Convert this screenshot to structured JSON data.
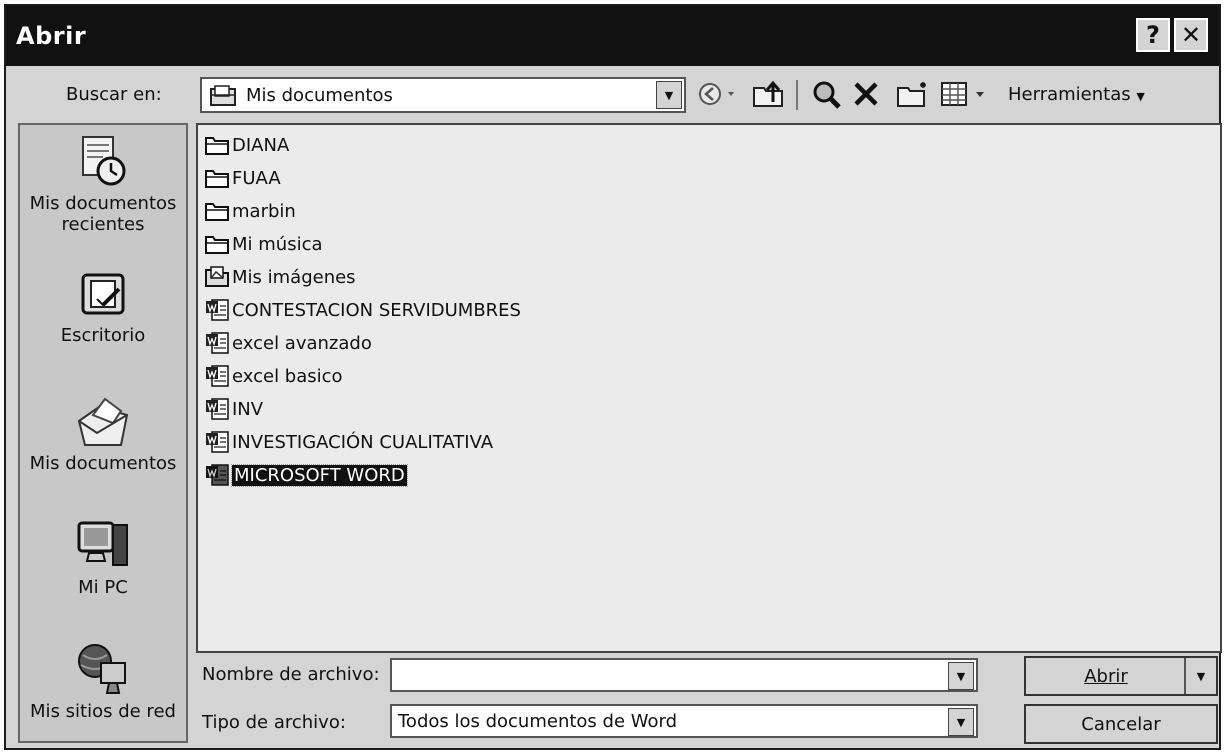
{
  "window": {
    "title": "Abrir",
    "help_label": "?",
    "close_label": "✕"
  },
  "toolbar": {
    "lookin_label": "Buscar en:",
    "lookin_value": "Mis documentos",
    "tools_label": "Herramientas",
    "icons": [
      "back-icon",
      "up-folder-icon",
      "search-web-icon",
      "delete-icon",
      "new-folder-icon",
      "views-icon"
    ]
  },
  "places": [
    {
      "line1": "Mis documentos",
      "line2": "recientes",
      "icon": "recent-documents-icon"
    },
    {
      "line1": "Escritorio",
      "line2": "",
      "icon": "desktop-icon"
    },
    {
      "line1": "Mis documentos",
      "line2": "",
      "icon": "my-documents-icon"
    },
    {
      "line1": "Mi PC",
      "line2": "",
      "icon": "my-computer-icon"
    },
    {
      "line1": "Mis sitios de red",
      "line2": "",
      "icon": "network-places-icon"
    }
  ],
  "files": [
    {
      "name": "DIANA",
      "type": "folder"
    },
    {
      "name": "FUAA",
      "type": "folder"
    },
    {
      "name": "marbin",
      "type": "folder"
    },
    {
      "name": "Mi música",
      "type": "folder"
    },
    {
      "name": "Mis imágenes",
      "type": "pictures-folder"
    },
    {
      "name": "CONTESTACION SERVIDUMBRES",
      "type": "word"
    },
    {
      "name": "excel avanzado",
      "type": "word"
    },
    {
      "name": "excel basico",
      "type": "word"
    },
    {
      "name": "INV",
      "type": "word"
    },
    {
      "name": "INVESTIGACIÓN CUALITATIVA",
      "type": "word"
    },
    {
      "name": "MICROSOFT WORD",
      "type": "word",
      "selected": true
    }
  ],
  "bottom": {
    "filename_label": "Nombre de archivo:",
    "filename_value": "",
    "filetype_label": "Tipo de archivo:",
    "filetype_value": "Todos los documentos de Word",
    "open_label": "Abrir",
    "cancel_label": "Cancelar"
  },
  "colors": {
    "titlebar": "#111111",
    "dialog": "#d4d4d4",
    "list": "#ebebeb",
    "selection": "#111111"
  }
}
